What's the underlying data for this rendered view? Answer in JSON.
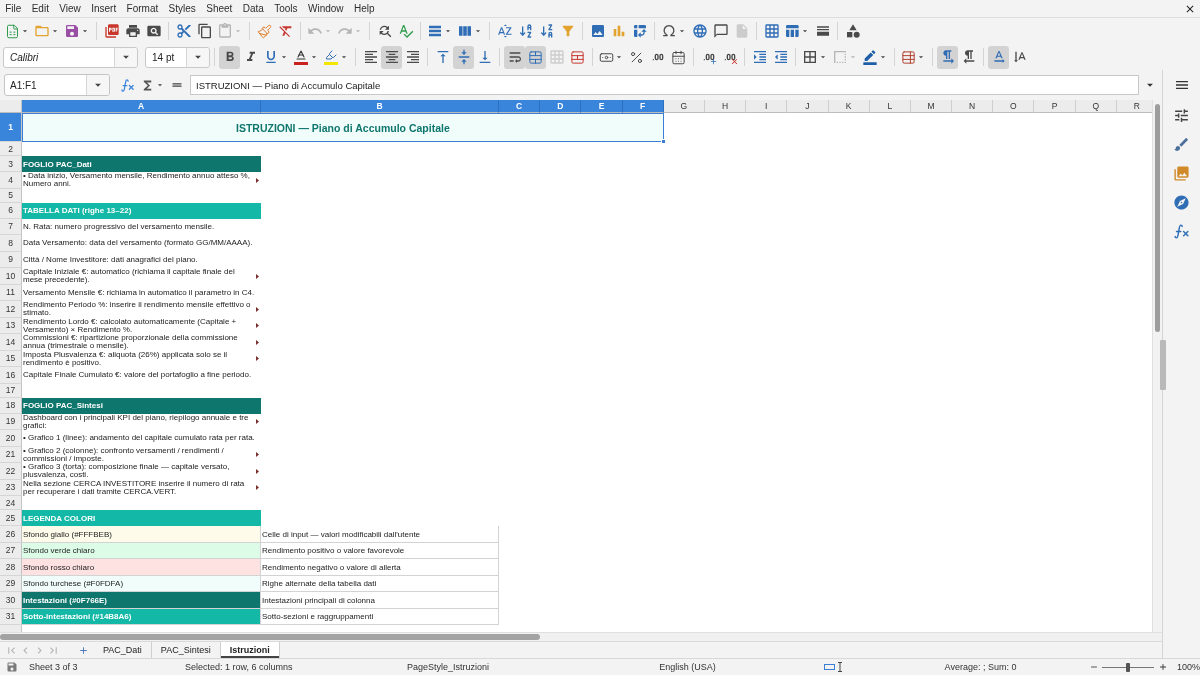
{
  "menu_bar": {
    "items": [
      "File",
      "Edit",
      "View",
      "Insert",
      "Format",
      "Styles",
      "Sheet",
      "Data",
      "Tools",
      "Window",
      "Help"
    ]
  },
  "standard_toolbar": [
    [
      {
        "kind": "new",
        "disabled": false
      },
      {
        "kind": "open",
        "disabled": false
      },
      {
        "kind": "save",
        "disabled": false
      }
    ],
    [
      {
        "kind": "export_pdf",
        "disabled": false
      },
      {
        "kind": "print",
        "disabled": false
      },
      {
        "kind": "print_preview",
        "disabled": false
      }
    ],
    [
      {
        "kind": "cut",
        "disabled": false
      },
      {
        "kind": "copy",
        "disabled": false
      },
      {
        "kind": "paste",
        "disabled": true
      }
    ],
    [
      {
        "kind": "clone_formatting",
        "disabled": false
      },
      {
        "kind": "clear_formatting",
        "disabled": false
      }
    ],
    [
      {
        "kind": "undo",
        "disabled": true
      },
      {
        "kind": "redo",
        "disabled": true
      }
    ],
    [
      {
        "kind": "find_replace",
        "disabled": false
      },
      {
        "kind": "spelling",
        "disabled": false
      }
    ],
    [
      {
        "kind": "row",
        "disabled": false
      },
      {
        "kind": "column",
        "disabled": false
      }
    ],
    [
      {
        "kind": "sort",
        "disabled": false
      },
      {
        "kind": "sort_ascending",
        "disabled": false
      },
      {
        "kind": "sort_descending",
        "disabled": false
      },
      {
        "kind": "autofilter",
        "disabled": false
      }
    ],
    [
      {
        "kind": "image",
        "disabled": false
      },
      {
        "kind": "chart",
        "disabled": false
      },
      {
        "kind": "pivot_table",
        "disabled": false
      }
    ],
    [
      {
        "kind": "special_character",
        "disabled": false
      },
      {
        "kind": "hyperlink",
        "disabled": false
      },
      {
        "kind": "comment",
        "disabled": false
      },
      {
        "kind": "header_footer",
        "disabled": true
      }
    ],
    [
      {
        "kind": "print_area",
        "disabled": false
      },
      {
        "kind": "freeze",
        "disabled": false
      },
      {
        "kind": "split_window",
        "disabled": false
      }
    ],
    [
      {
        "kind": "draw",
        "disabled": false
      }
    ]
  ],
  "formatting_toolbar": {
    "font_name": "Calibri",
    "font_size": "14 pt",
    "groups": [
      [
        {
          "kind": "bold",
          "on": true,
          "disabled": false
        },
        {
          "kind": "italic",
          "on": false,
          "disabled": false
        },
        {
          "kind": "underline",
          "on": false,
          "disabled": false
        },
        {
          "kind": "font_color",
          "on": false,
          "disabled": false
        },
        {
          "kind": "highlight",
          "on": false,
          "disabled": false
        }
      ],
      [
        {
          "kind": "align_left",
          "on": false,
          "disabled": false
        },
        {
          "kind": "align_center",
          "on": true,
          "disabled": false
        },
        {
          "kind": "align_right",
          "on": false,
          "disabled": false
        }
      ],
      [
        {
          "kind": "align_top",
          "on": false,
          "disabled": false
        },
        {
          "kind": "align_middle",
          "on": true,
          "disabled": false
        },
        {
          "kind": "align_bottom",
          "on": false,
          "disabled": false
        }
      ],
      [
        {
          "kind": "wrap_text",
          "on": true,
          "disabled": false
        },
        {
          "kind": "merge_center",
          "on": true,
          "disabled": false
        },
        {
          "kind": "merge",
          "on": false,
          "disabled": true
        },
        {
          "kind": "unmerge",
          "on": false,
          "disabled": false
        }
      ],
      [
        {
          "kind": "currency",
          "on": false,
          "disabled": false
        },
        {
          "kind": "percent",
          "on": false,
          "disabled": false
        },
        {
          "kind": "standard",
          "on": false,
          "disabled": false
        },
        {
          "kind": "date",
          "on": false,
          "disabled": false
        }
      ],
      [
        {
          "kind": "add_decimal",
          "on": false,
          "disabled": false
        },
        {
          "kind": "delete_decimal",
          "on": false,
          "disabled": false
        }
      ],
      [
        {
          "kind": "indent_increase",
          "on": false,
          "disabled": false
        },
        {
          "kind": "indent_decrease",
          "on": false,
          "disabled": false
        }
      ],
      [
        {
          "kind": "borders",
          "on": false,
          "disabled": false
        },
        {
          "kind": "border_style",
          "on": false,
          "disabled": true
        },
        {
          "kind": "border_color",
          "on": false,
          "disabled": false
        }
      ],
      [
        {
          "kind": "conditional",
          "on": false,
          "disabled": false
        }
      ],
      [
        {
          "kind": "ltr",
          "on": true,
          "disabled": false
        },
        {
          "kind": "rtl",
          "on": false,
          "disabled": false
        }
      ],
      [
        {
          "kind": "text_horizontal",
          "on": true,
          "disabled": false
        },
        {
          "kind": "text_vertical",
          "on": false,
          "disabled": false
        }
      ]
    ]
  },
  "formula_bar": {
    "name_box": "A1:F1",
    "content": "ISTRUZIONI — Piano di Accumulo Capitale"
  },
  "sheet": {
    "columns": [
      {
        "label": "A",
        "selected": true
      },
      {
        "label": "B",
        "selected": true
      },
      {
        "label": "C",
        "selected": true
      },
      {
        "label": "D",
        "selected": true
      },
      {
        "label": "E",
        "selected": true
      },
      {
        "label": "F",
        "selected": true
      },
      {
        "label": "G",
        "selected": false
      },
      {
        "label": "H",
        "selected": false
      },
      {
        "label": "I",
        "selected": false
      },
      {
        "label": "J",
        "selected": false
      },
      {
        "label": "K",
        "selected": false
      },
      {
        "label": "L",
        "selected": false
      },
      {
        "label": "M",
        "selected": false
      },
      {
        "label": "N",
        "selected": false
      },
      {
        "label": "O",
        "selected": false
      },
      {
        "label": "P",
        "selected": false
      },
      {
        "label": "Q",
        "selected": false
      },
      {
        "label": "R",
        "selected": false
      }
    ],
    "rows": [
      {
        "number": "1",
        "selected": true,
        "cells": [
          {
            "kind": "title",
            "text": "ISTRUZIONI — Piano di Accumulo Capitale"
          }
        ]
      },
      {
        "number": "2",
        "selected": false
      },
      {
        "number": "3",
        "selected": false,
        "cells": [
          {
            "kind": "header",
            "text": "FOGLIO PAC_Dati"
          }
        ]
      },
      {
        "number": "4",
        "selected": false,
        "cells": [
          {
            "kind": "text",
            "text": "• Data inizio, Versamento mensile, Rendimento annuo atteso %, Numero anni.",
            "overflow": true
          }
        ]
      },
      {
        "number": "5",
        "selected": false
      },
      {
        "number": "6",
        "selected": false,
        "cells": [
          {
            "kind": "subheader",
            "text": "TABELLA DATI (righe 13–22)"
          }
        ]
      },
      {
        "number": "7",
        "selected": false,
        "cells": [
          {
            "kind": "text",
            "text": "N. Rata: numero progressivo del versamento mensile.",
            "overflow": false
          }
        ]
      },
      {
        "number": "8",
        "selected": false,
        "cells": [
          {
            "kind": "text",
            "text": "Data Versamento: data del versamento (formato GG/MM/AAAA).",
            "overflow": false
          }
        ]
      },
      {
        "number": "9",
        "selected": false,
        "cells": [
          {
            "kind": "text",
            "text": "Città / Nome Investitore: dati anagrafici del piano.",
            "overflow": false
          }
        ]
      },
      {
        "number": "10",
        "selected": false,
        "cells": [
          {
            "kind": "text",
            "text": "Capitale Iniziale €: automatico (richiama il capitale finale del mese precedente).",
            "overflow": true
          }
        ]
      },
      {
        "number": "11",
        "selected": false,
        "cells": [
          {
            "kind": "text",
            "text": "Versamento Mensile €: richiama in automatico il parametro in C4.",
            "overflow": false
          }
        ]
      },
      {
        "number": "12",
        "selected": false,
        "cells": [
          {
            "kind": "text",
            "text": "Rendimento Periodo %: inserire il rendimento mensile effettivo o stimato.",
            "overflow": true
          }
        ]
      },
      {
        "number": "13",
        "selected": false,
        "cells": [
          {
            "kind": "text",
            "text": "Rendimento Lordo €: calcolato automaticamente (Capitale + Versamento) × Rendimento %.",
            "overflow": true
          }
        ]
      },
      {
        "number": "14",
        "selected": false,
        "cells": [
          {
            "kind": "text",
            "text": "Commissioni €: ripartizione proporzionale della commissione annua (trimestrale o mensile).",
            "overflow": true
          }
        ]
      },
      {
        "number": "15",
        "selected": false,
        "cells": [
          {
            "kind": "text",
            "text": "Imposta Plusvalenza €: aliquota (26%) applicata solo se il rendimento è positivo.",
            "overflow": true
          }
        ]
      },
      {
        "number": "16",
        "selected": false,
        "cells": [
          {
            "kind": "text",
            "text": "Capitale Finale Cumulato €: valore del portafoglio a fine periodo.",
            "overflow": false
          }
        ]
      },
      {
        "number": "17",
        "selected": false
      },
      {
        "number": "18",
        "selected": false,
        "cells": [
          {
            "kind": "header",
            "text": "FOGLIO PAC_Sintesi"
          }
        ]
      },
      {
        "number": "19",
        "selected": false,
        "cells": [
          {
            "kind": "text",
            "text": "Dashboard con i principali KPI del piano, riepilogo annuale e tre grafici:",
            "overflow": true
          }
        ]
      },
      {
        "number": "20",
        "selected": false,
        "cells": [
          {
            "kind": "text",
            "text": "• Grafico 1 (linee): andamento del capitale cumulato rata per rata.",
            "overflow": false
          }
        ]
      },
      {
        "number": "21",
        "selected": false,
        "cells": [
          {
            "kind": "text",
            "text": "• Grafico 2 (colonne): confronto versamenti / rendimenti / commissioni / imposte.",
            "overflow": true
          }
        ]
      },
      {
        "number": "22",
        "selected": false,
        "cells": [
          {
            "kind": "text",
            "text": "• Grafico 3 (torta): composizione finale — capitale versato, plusvalenza, costi.",
            "overflow": true
          }
        ]
      },
      {
        "number": "23",
        "selected": false,
        "cells": [
          {
            "kind": "text",
            "text": "Nella sezione CERCA INVESTITORE inserire il numero di rata per recuperare i dati tramite CERCA.VERT.",
            "overflow": true
          }
        ]
      },
      {
        "number": "24",
        "selected": false
      },
      {
        "number": "25",
        "selected": false,
        "cells": [
          {
            "kind": "subheader",
            "text": "LEGENDA COLORI"
          }
        ]
      },
      {
        "number": "26",
        "selected": false,
        "cells": [
          {
            "kind": "swatch",
            "text": "Sfondo giallo (#FFFBEB)",
            "color": "#fffbeb"
          },
          {
            "kind": "note",
            "text": "Celle di input — valori modificabili dall'utente"
          }
        ]
      },
      {
        "number": "27",
        "selected": false,
        "cells": [
          {
            "kind": "swatch",
            "text": "Sfondo verde chiaro",
            "color": "#dcfce7"
          },
          {
            "kind": "note",
            "text": "Rendimento positivo o valore favorevole"
          }
        ]
      },
      {
        "number": "28",
        "selected": false,
        "cells": [
          {
            "kind": "swatch",
            "text": "Sfondo rosso chiaro",
            "color": "#fee2e2"
          },
          {
            "kind": "note",
            "text": "Rendimento negativo o valore di allerta"
          }
        ]
      },
      {
        "number": "29",
        "selected": false,
        "cells": [
          {
            "kind": "swatch",
            "text": "Sfondo turchese (#F0FDFA)",
            "color": "#f0fdfa"
          },
          {
            "kind": "note",
            "text": "Righe alternate della tabella dati"
          }
        ]
      },
      {
        "number": "30",
        "selected": false,
        "cells": [
          {
            "kind": "swatch",
            "text": "Intestazioni (#0F766E)",
            "color": "#0f766e"
          },
          {
            "kind": "note",
            "text": "Intestazioni principali di colonna"
          }
        ]
      },
      {
        "number": "31",
        "selected": false,
        "cells": [
          {
            "kind": "swatch",
            "text": "Sotto-intestazioni (#14B8A6)",
            "color": "#14b8a6"
          },
          {
            "kind": "note",
            "text": "Sotto-sezioni e raggruppamenti"
          }
        ]
      }
    ]
  },
  "sheet_tabs": [
    {
      "label": "PAC_Dati",
      "selected": false
    },
    {
      "label": "PAC_Sintesi",
      "selected": false
    },
    {
      "label": "Istruzioni",
      "selected": true
    }
  ],
  "status_bar": {
    "sheet_position": "Sheet 3 of 3",
    "selection": "Selected: 1 row, 6 columns",
    "page_style": "PageStyle_Istruzioni",
    "language": "English (USA)",
    "summary": "Average: ; Sum: 0",
    "zoom": {
      "level": 0.5,
      "percent": "100%"
    }
  }
}
